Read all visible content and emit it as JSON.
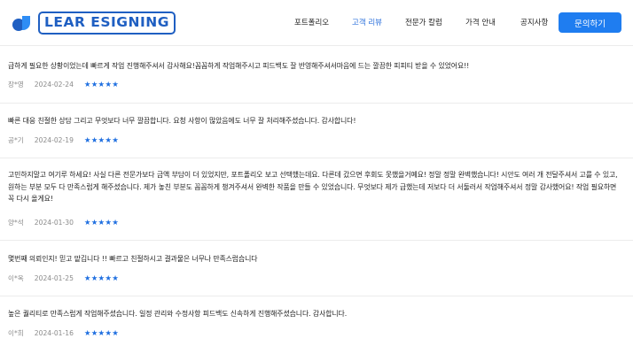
{
  "brand": {
    "logo_text": "LEAR ESIGNING",
    "accent_color": "#1f5fc2"
  },
  "nav": {
    "items": [
      {
        "label": "포트폴리오",
        "active": false
      },
      {
        "label": "고객 리뷰",
        "active": true
      },
      {
        "label": "전문가 칼럼",
        "active": false
      },
      {
        "label": "가격 안내",
        "active": false
      },
      {
        "label": "공지사항",
        "active": false
      }
    ],
    "cta_label": "문의하기"
  },
  "reviews": [
    {
      "text": "급하게 필요한 상황이었는데 빠르게 작업 진행해주셔서 감사해요!꼼꼼하게 작업해주시고 피드백도 잘 반영해주셔서마음에 드는 깔끔한 피피티 받을 수 있었어요!!",
      "author": "장*영",
      "date": "2024-02-24",
      "rating": 5,
      "stars": "★★★★★"
    },
    {
      "text": "빠른 대응 친절한 상담 그리고 무엇보다 너무 깔끔합니다. 요청 사항이 많았음에도 너무 잘 처리해주셨습니다. 감사합니다!",
      "author": "공*기",
      "date": "2024-02-19",
      "rating": 5,
      "stars": "★★★★★"
    },
    {
      "text": "고민하지말고 여기루 하세요! 사실 다른 전문가보다 금액 부담이 더 있었지만, 포트폴리오 보고 선택했는데요. 다른데 갔으면 후회도 못했을거예요! 정말 정말 완벽했습니다! 시안도 여러 개 전달주셔서 고를 수 있고, 원하는 부분 모두 다 만족스럽게 해주셨습니다. 제가 놓친 부분도 꼼꼼하게 챙겨주셔서 완벽한 작품을 만들 수 있었습니다. 무엇보다 제가 급했는데 저보다 더 서둘러서 작업해주셔서 정말 감사했어요! 작업 필요하면 꼭 다시 올게요!",
      "author": "양*석",
      "date": "2024-01-30",
      "rating": 5,
      "stars": "★★★★★"
    },
    {
      "text": "몇번째 의뢰인지! 믿고 맡깁니다 !! 빠르고 친절하시고 결과물은 너무나 만족스럽습니다",
      "author": "이*옥",
      "date": "2024-01-25",
      "rating": 5,
      "stars": "★★★★★"
    },
    {
      "text": "높은 퀄리티로 만족스럽게 작업해주셨습니다. 일정 관리와 수정사항 피드백도 신속하게 진행해주셨습니다. 감사합니다.",
      "author": "이*희",
      "date": "2024-01-16",
      "rating": 5,
      "stars": "★★★★★"
    }
  ]
}
